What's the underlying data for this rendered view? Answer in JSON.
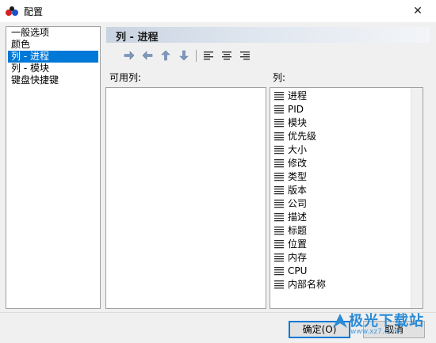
{
  "window": {
    "title": "配置",
    "close_symbol": "✕"
  },
  "sidebar": {
    "items": [
      {
        "label": "一般选项",
        "selected": false
      },
      {
        "label": "颜色",
        "selected": false
      },
      {
        "label": "列 - 进程",
        "selected": true
      },
      {
        "label": "列 - 模块",
        "selected": false
      },
      {
        "label": "键盘快捷键",
        "selected": false
      }
    ]
  },
  "panel": {
    "title": "列 - 进程"
  },
  "toolbar": {
    "buttons": [
      {
        "icon": "arrow-right-icon"
      },
      {
        "icon": "arrow-left-icon"
      },
      {
        "icon": "arrow-up-icon"
      },
      {
        "icon": "arrow-down-icon"
      },
      {
        "icon": "align-left-icon"
      },
      {
        "icon": "align-center-icon"
      },
      {
        "icon": "align-right-icon"
      }
    ]
  },
  "available_columns": {
    "label": "可用列:",
    "items": []
  },
  "columns": {
    "label": "列:",
    "items": [
      "进程",
      "PID",
      "模块",
      "优先级",
      "大小",
      "修改",
      "类型",
      "版本",
      "公司",
      "描述",
      "标题",
      "位置",
      "内存",
      "CPU",
      "内部名称"
    ]
  },
  "buttons": {
    "ok": "确定(O)",
    "cancel": "取消"
  },
  "watermark": {
    "text": "极光下载站",
    "url": "www.xz7.com"
  },
  "colors": {
    "accent": "#0078d7",
    "arrow": "#7f98bc"
  }
}
